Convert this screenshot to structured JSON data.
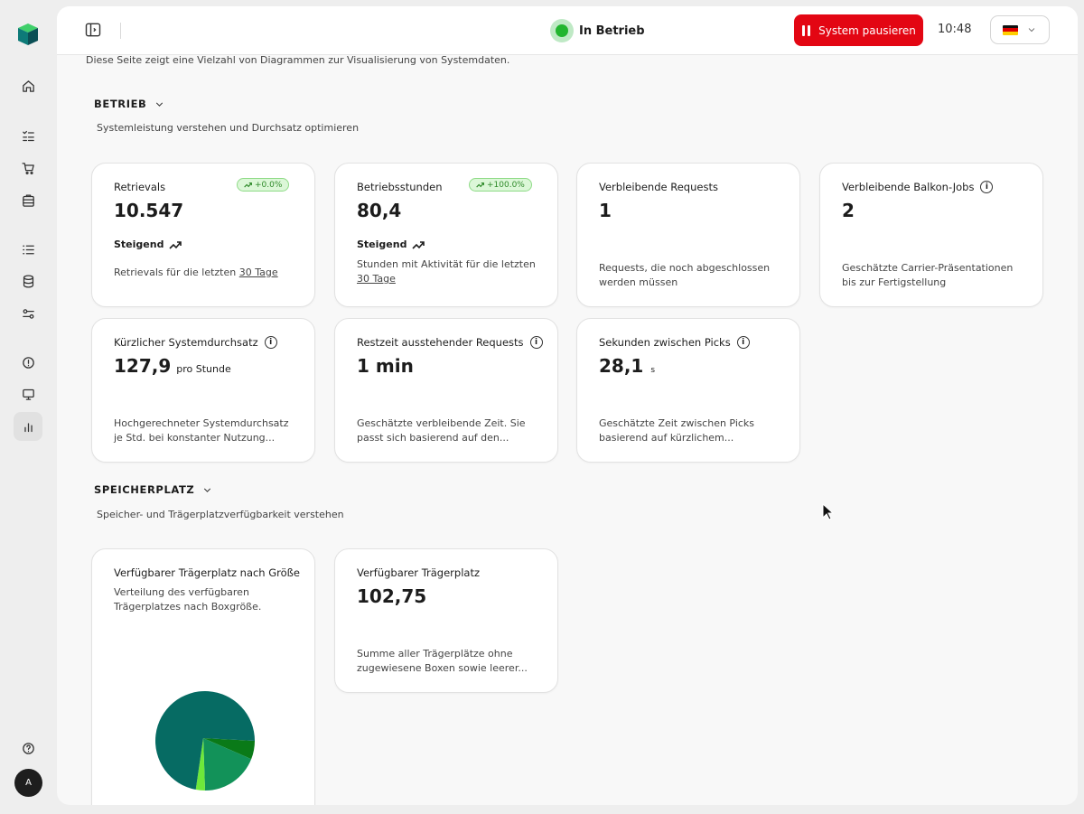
{
  "sidebar": {
    "avatar_initial": "A"
  },
  "topbar": {
    "status": "In Betrieb",
    "pause_label": "System pausieren",
    "time": "10:48",
    "status_color": "#22b52f",
    "pause_color": "#e30613"
  },
  "page": {
    "description": "Diese Seite zeigt eine Vielzahl von Diagrammen zur Visualisierung von Systemdaten."
  },
  "sections": {
    "betrieb": {
      "title": "BETRIEB",
      "subtitle": "Systemleistung verstehen und Durchsatz optimieren"
    },
    "speicher": {
      "title": "SPEICHERPLATZ",
      "subtitle": "Speicher- und Trägerplatzverfügbarkeit verstehen"
    }
  },
  "cards": {
    "retrievals": {
      "title": "Retrievals",
      "badge": "+0.0%",
      "value": "10.547",
      "trend": "Steigend",
      "desc": "Retrievals für die letzten",
      "link": "30 Tage"
    },
    "betriebsstunden": {
      "title": "Betriebsstunden",
      "badge": "+100.0%",
      "value": "80,4",
      "trend": "Steigend",
      "desc": "Stunden mit Aktivität für die letzten",
      "link": "30 Tage"
    },
    "requests": {
      "title": "Verbleibende Requests",
      "value": "1",
      "desc": "Requests, die noch abgeschlossen werden müssen"
    },
    "balkon": {
      "title": "Verbleibende Balkon-Jobs",
      "value": "2",
      "desc": "Geschätzte Carrier-Präsentationen bis zur Fertigstellung"
    },
    "durchsatz": {
      "title": "Kürzlicher Systemdurchsatz",
      "value": "127,9",
      "unit": "pro Stunde",
      "desc": "Hochgerechneter Systemdurchsatz je Std. bei konstanter Nutzung..."
    },
    "restzeit": {
      "title": "Restzeit ausstehender Requests",
      "value": "1 min",
      "desc": "Geschätzte verbleibende Zeit. Sie passt sich basierend auf den..."
    },
    "picks": {
      "title": "Sekunden zwischen Picks",
      "value": "28,1",
      "unit": "s",
      "desc": "Geschätzte Zeit zwischen Picks basierend auf kürzlichem..."
    },
    "traeger_groesse": {
      "title": "Verfügbarer Trägerplatz nach Größe",
      "desc": "Verteilung des verfügbaren Trägerplatzes nach Boxgröße."
    },
    "traeger": {
      "title": "Verfügbarer Trägerplatz",
      "value": "102,75",
      "desc": "Summe aller Trägerplätze ohne zugewiesene Boxen sowie leerer..."
    }
  },
  "chart_data": {
    "type": "pie",
    "values": [
      72,
      6,
      19,
      3
    ],
    "colors": [
      "#066b63",
      "#0a7a18",
      "#129259",
      "#6ee83a"
    ]
  }
}
